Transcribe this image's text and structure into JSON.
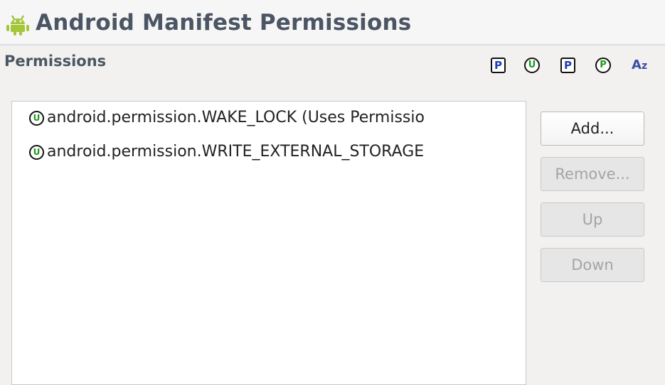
{
  "header": {
    "title": "Android Manifest Permissions",
    "icon": "android-robot-icon"
  },
  "section": {
    "title": "Permissions"
  },
  "toolbar": {
    "items": [
      {
        "icon": "add-permission-icon",
        "glyph": "P"
      },
      {
        "icon": "add-uses-permission-icon",
        "glyph": "U"
      },
      {
        "icon": "add-permission-tree-icon",
        "glyph": "P"
      },
      {
        "icon": "add-permission-group-icon",
        "glyph": "P"
      },
      {
        "icon": "sort-alphabetical-icon",
        "glyph_a": "A",
        "glyph_z": "z"
      }
    ]
  },
  "permissions": [
    {
      "icon": "uses-permission-icon",
      "glyph": "U",
      "label": "android.permission.WAKE_LOCK (Uses Permissio"
    },
    {
      "icon": "uses-permission-icon",
      "glyph": "U",
      "label": "android.permission.WRITE_EXTERNAL_STORAGE"
    }
  ],
  "buttons": {
    "add": "Add...",
    "remove": "Remove...",
    "up": "Up",
    "down": "Down"
  },
  "colors": {
    "android_green": "#a4c639",
    "uses_permission_green": "#1a9a1a",
    "permission_blue": "#1f3fb3"
  }
}
